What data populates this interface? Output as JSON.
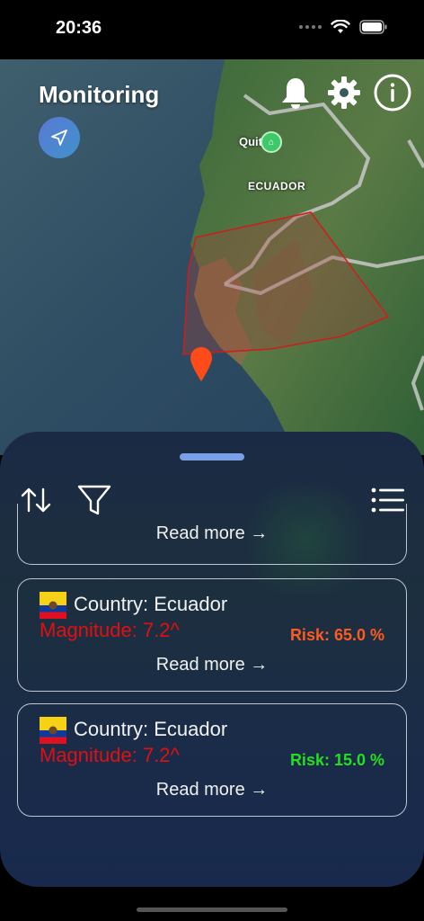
{
  "status_bar": {
    "time": "20:36"
  },
  "map": {
    "title": "Monitoring",
    "capital_label": "Quit",
    "country_label": "ECUADOR"
  },
  "sheet": {
    "partial_card": {
      "read_more": "Read more →"
    },
    "cards": [
      {
        "country": "Country: Ecuador",
        "magnitude": "Magnitude: 7.2^",
        "risk": "Risk: 65.0 %",
        "risk_color": "#ff5a1f",
        "read_more": "Read more →"
      },
      {
        "country": "Country: Ecuador",
        "magnitude": "Magnitude: 7.2^",
        "risk": "Risk: 15.0 %",
        "risk_color": "#22e01c",
        "read_more": "Read more →"
      }
    ]
  },
  "icons": {
    "locate": "navigation-arrow-icon",
    "bell": "bell-icon",
    "settings": "gear-icon",
    "info": "info-icon",
    "sort": "sort-arrows-icon",
    "filter": "filter-funnel-icon",
    "list": "list-icon"
  },
  "colors": {
    "magnitude": "#e01010",
    "alert_region": "#d01c1c",
    "pin": "#ff4a1a"
  }
}
